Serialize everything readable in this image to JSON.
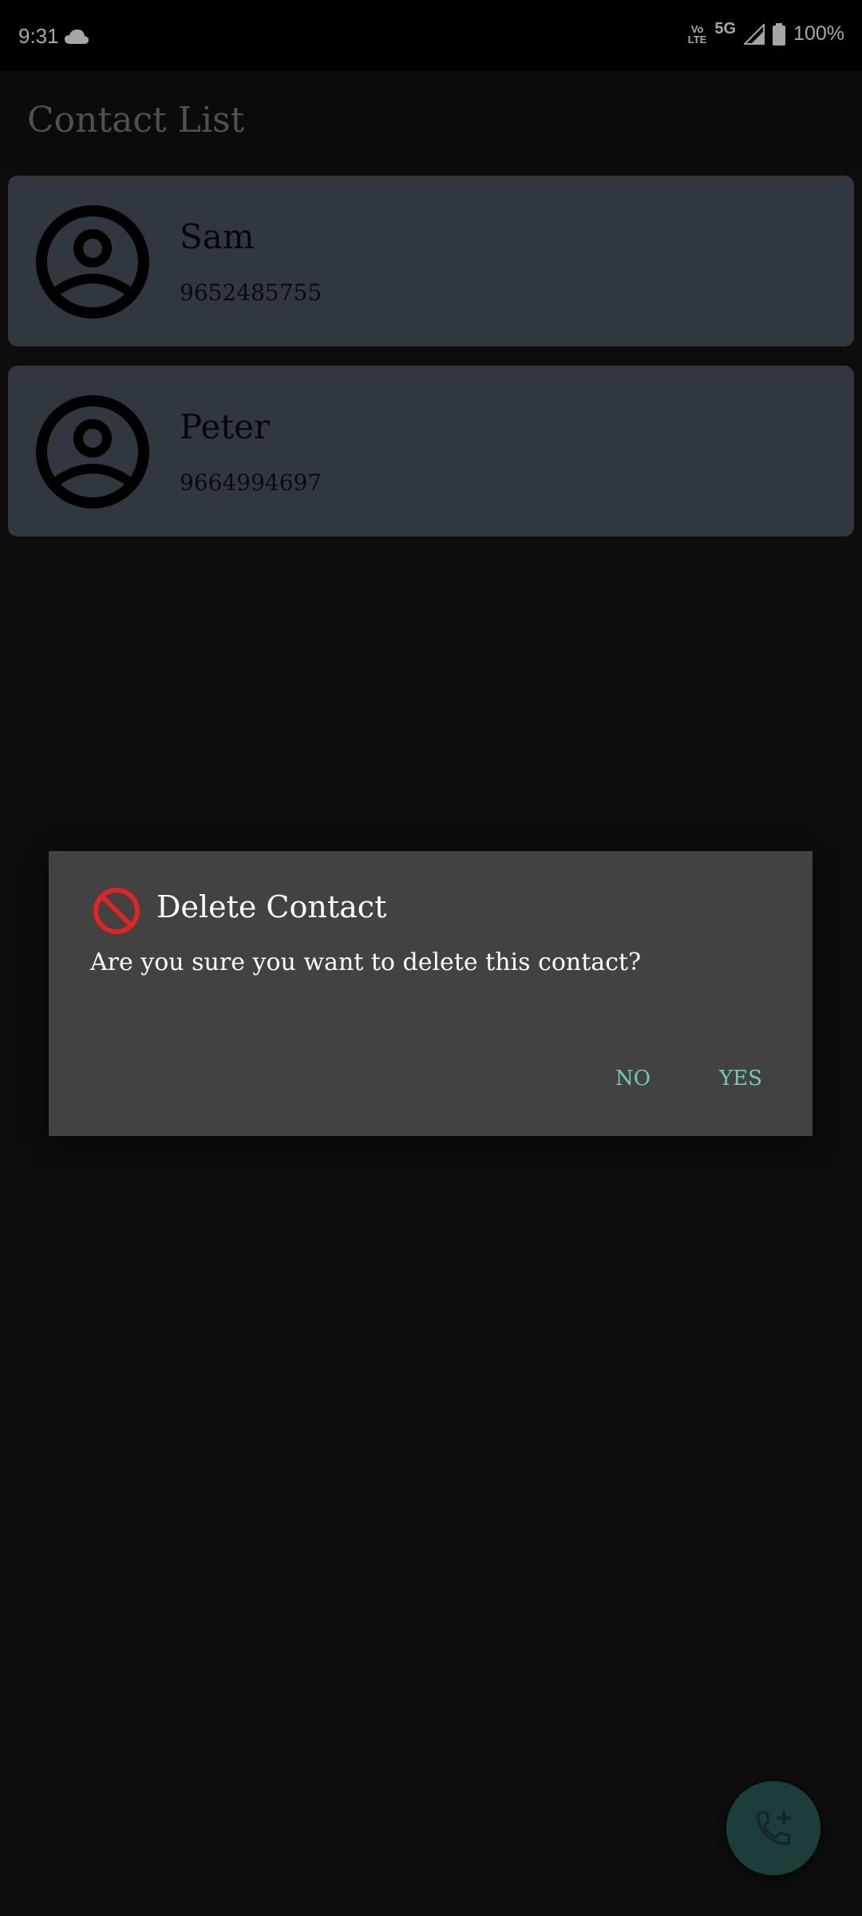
{
  "status_bar": {
    "time": "9:31",
    "network": "5G",
    "volte_top": "Vo",
    "volte_bottom": "LTE",
    "battery": "100%"
  },
  "app": {
    "title": "Contact List"
  },
  "contacts": [
    {
      "name": "Sam",
      "phone": "9652485755"
    },
    {
      "name": "Peter",
      "phone": "9664994697"
    }
  ],
  "dialog": {
    "title": "Delete Contact",
    "message": "Are you sure you want to delete this contact?",
    "no_label": "NO",
    "yes_label": "YES",
    "icon": "block-icon",
    "icon_color": "#e02424",
    "button_color": "#76c6c0"
  },
  "fab": {
    "icon": "add-call-icon"
  }
}
